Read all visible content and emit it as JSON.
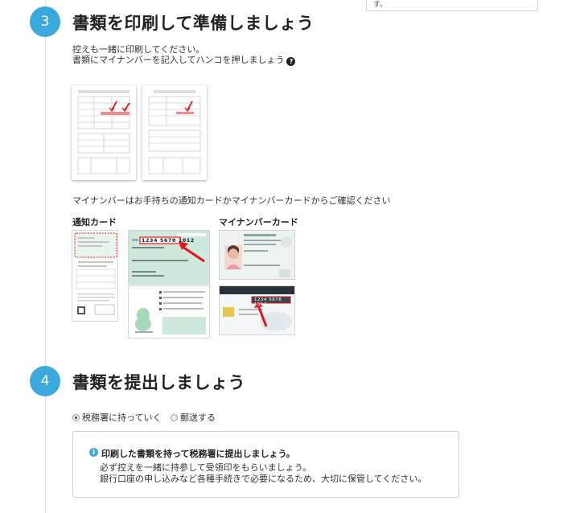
{
  "top_box": {
    "text": "す。"
  },
  "step3": {
    "number": "3",
    "title": "書類を印刷して準備しましょう",
    "desc_line1": "控えも一緒に印刷してください。",
    "desc_line2": "書類にマイナンバーを記入してハンコを押しましょう",
    "help_icon": "?",
    "card_note": "マイナンバーはお手持ちの通知カードかマイナンバーカードからご確認ください",
    "notice_card_heading": "通知カード",
    "mynumber_card_heading": "マイナンバーカード",
    "sample_number": "1234 5678 1012"
  },
  "step4": {
    "number": "4",
    "title": "書類を提出しましょう",
    "radio_options": [
      {
        "label": "税務署に持っていく",
        "checked": true
      },
      {
        "label": "郵送する",
        "checked": false
      }
    ],
    "info_icon": "i",
    "info_title": "印刷した書類を持って税務署に提出しましょう。",
    "info_line1": "必ず控えを一緒に持参して受領印をもらいましょう。",
    "info_line2": "銀行口座の申し込みなど各種手続きで必要になるため、大切に保管してください。"
  },
  "colors": {
    "accent": "#3ba9de",
    "arrow_red": "#e8141c",
    "notice_green": "#cfe8dc"
  }
}
